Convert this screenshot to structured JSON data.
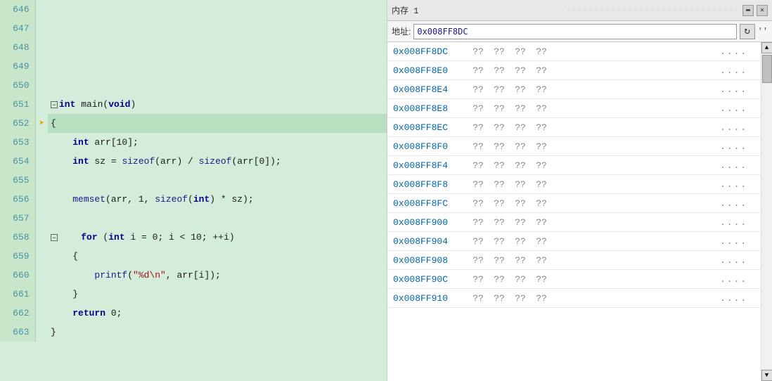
{
  "editor": {
    "lines": [
      {
        "num": "646",
        "arrow": false,
        "collapse": false,
        "content": ""
      },
      {
        "num": "647",
        "arrow": false,
        "collapse": false,
        "content": ""
      },
      {
        "num": "648",
        "arrow": false,
        "collapse": false,
        "content": ""
      },
      {
        "num": "649",
        "arrow": false,
        "collapse": false,
        "content": ""
      },
      {
        "num": "650",
        "arrow": false,
        "collapse": false,
        "content": ""
      },
      {
        "num": "651",
        "arrow": false,
        "collapse": true,
        "content": "int main(void)",
        "is_current": false
      },
      {
        "num": "652",
        "arrow": true,
        "collapse": false,
        "content": "{",
        "is_current": true
      },
      {
        "num": "653",
        "arrow": false,
        "collapse": false,
        "content": "    int arr[10];"
      },
      {
        "num": "654",
        "arrow": false,
        "collapse": false,
        "content": "    int sz = sizeof(arr) / sizeof(arr[0]);"
      },
      {
        "num": "655",
        "arrow": false,
        "collapse": false,
        "content": ""
      },
      {
        "num": "656",
        "arrow": false,
        "collapse": false,
        "content": "    memset(arr, 1, sizeof(int) * sz);"
      },
      {
        "num": "657",
        "arrow": false,
        "collapse": false,
        "content": ""
      },
      {
        "num": "658",
        "arrow": false,
        "collapse": true,
        "content": "    for (int i = 0; i < 10; ++i)"
      },
      {
        "num": "659",
        "arrow": false,
        "collapse": false,
        "content": "    {"
      },
      {
        "num": "660",
        "arrow": false,
        "collapse": false,
        "content": "        printf(\"%d\\n\", arr[i]);"
      },
      {
        "num": "661",
        "arrow": false,
        "collapse": false,
        "content": "    }"
      },
      {
        "num": "662",
        "arrow": false,
        "collapse": false,
        "content": "    return 0;"
      },
      {
        "num": "663",
        "arrow": false,
        "collapse": false,
        "content": "}"
      }
    ]
  },
  "memory": {
    "title": "内存 1",
    "addr_label": "地址:",
    "addr_value": "0x008FF8DC",
    "refresh_icon": "↻",
    "dots_icon": "''",
    "minimize_icon": "▬",
    "close_icon": "✕",
    "rows": [
      {
        "addr": "0x008FF8DC",
        "b1": "??",
        "b2": "??",
        "b3": "??",
        "b4": "??",
        "chars": "...."
      },
      {
        "addr": "0x008FF8E0",
        "b1": "??",
        "b2": "??",
        "b3": "??",
        "b4": "??",
        "chars": "...."
      },
      {
        "addr": "0x008FF8E4",
        "b1": "??",
        "b2": "??",
        "b3": "??",
        "b4": "??",
        "chars": "...."
      },
      {
        "addr": "0x008FF8E8",
        "b1": "??",
        "b2": "??",
        "b3": "??",
        "b4": "??",
        "chars": "...."
      },
      {
        "addr": "0x008FF8EC",
        "b1": "??",
        "b2": "??",
        "b3": "??",
        "b4": "??",
        "chars": "...."
      },
      {
        "addr": "0x008FF8F0",
        "b1": "??",
        "b2": "??",
        "b3": "??",
        "b4": "??",
        "chars": "...."
      },
      {
        "addr": "0x008FF8F4",
        "b1": "??",
        "b2": "??",
        "b3": "??",
        "b4": "??",
        "chars": "...."
      },
      {
        "addr": "0x008FF8F8",
        "b1": "??",
        "b2": "??",
        "b3": "??",
        "b4": "??",
        "chars": "...."
      },
      {
        "addr": "0x008FF8FC",
        "b1": "??",
        "b2": "??",
        "b3": "??",
        "b4": "??",
        "chars": "...."
      },
      {
        "addr": "0x008FF900",
        "b1": "??",
        "b2": "??",
        "b3": "??",
        "b4": "??",
        "chars": "...."
      },
      {
        "addr": "0x008FF904",
        "b1": "??",
        "b2": "??",
        "b3": "??",
        "b4": "??",
        "chars": "...."
      },
      {
        "addr": "0x008FF908",
        "b1": "??",
        "b2": "??",
        "b3": "??",
        "b4": "??",
        "chars": "...."
      },
      {
        "addr": "0x008FF90C",
        "b1": "??",
        "b2": "??",
        "b3": "??",
        "b4": "??",
        "chars": "...."
      },
      {
        "addr": "0x008FF910",
        "b1": "??",
        "b2": "??",
        "b3": "??",
        "b4": "??",
        "chars": "...."
      }
    ]
  }
}
